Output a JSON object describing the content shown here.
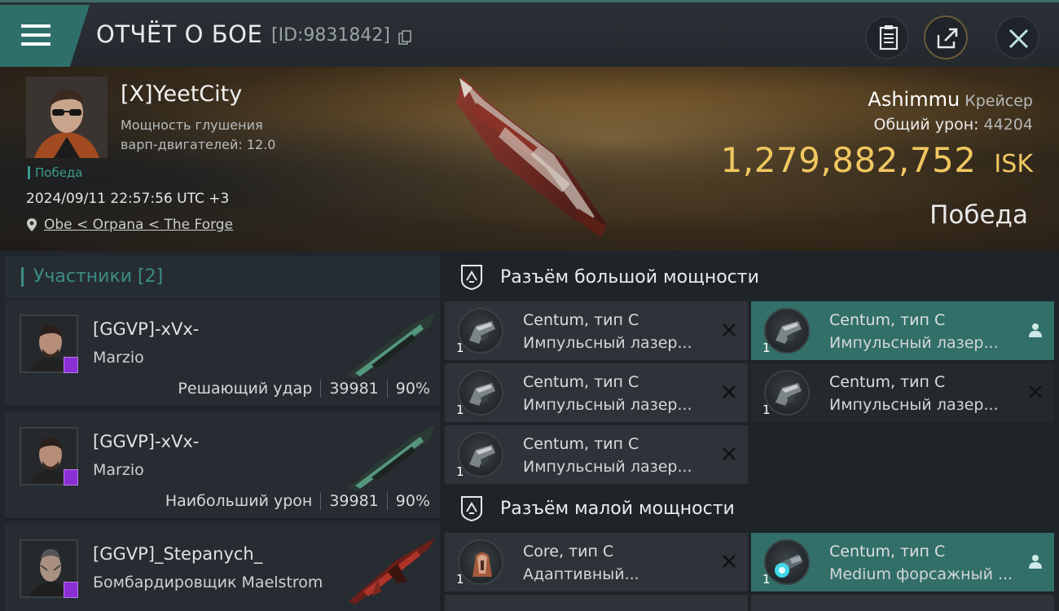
{
  "header": {
    "title": "ОТЧЁТ О БОЕ",
    "report_id": "[ID:9831842]"
  },
  "victim": {
    "pilot_name": "[X]YeetCity",
    "attribute_line1": "Мощность глушения",
    "attribute_line2": "варп-двигателей: 12.0",
    "result_tag": "Победа",
    "datetime": "2024/09/11 22:57:56 UTC +3",
    "location": "Obe < Orpana < The Forge",
    "ship_name": "Ashimmu",
    "ship_class": "Крейсер",
    "damage_label": "Общий урон:",
    "damage_value": "44204",
    "isk_value": "1,279,882,752",
    "isk_unit": "ISK",
    "result_big": "Победа"
  },
  "participants": {
    "header": "Участники [2]",
    "rows": [
      {
        "name": "[GGVP]-xVx-",
        "ship": "Marzio",
        "role": "Решающий удар",
        "damage": "39981",
        "percent": "90%"
      },
      {
        "name": "[GGVP]-xVx-",
        "ship": "Marzio",
        "role": "Наибольший урон",
        "damage": "39981",
        "percent": "90%"
      },
      {
        "name": "[GGVP]_Stepanych_",
        "ship": "Бомбардировщик Maelstrom"
      }
    ]
  },
  "fitting": {
    "high_header": "Разъём большой мощности",
    "low_header": "Разъём малой мощности",
    "high_modules": [
      {
        "name": "Centum, тип C",
        "desc": "Импульсный лазер...",
        "qty": "1",
        "action": "close-icon"
      },
      {
        "name": "Centum, тип C",
        "desc": "Импульсный лазер...",
        "qty": "1",
        "action": "person-icon"
      },
      {
        "name": "Centum, тип C",
        "desc": "Импульсный лазер...",
        "qty": "1",
        "action": "close-icon"
      },
      {
        "name": "Centum, тип C",
        "desc": "Импульсный лазер...",
        "qty": "1",
        "action": "close-icon"
      },
      {
        "name": "Centum, тип C",
        "desc": "Импульсный лазер...",
        "qty": "1",
        "action": "close-icon"
      }
    ],
    "low_modules": [
      {
        "name": "Core, тип C",
        "desc": "Адаптивный...",
        "qty": "1",
        "action": "close-icon"
      },
      {
        "name": "Centum, тип C",
        "desc": "Medium форсажный ...",
        "qty": "1",
        "action": "person-icon"
      }
    ]
  },
  "colors": {
    "accent_teal": "#326f69",
    "isk_gold": "#f0c760",
    "victory_green": "#3c9b8f",
    "badge_purple": "#8b2fd4"
  }
}
